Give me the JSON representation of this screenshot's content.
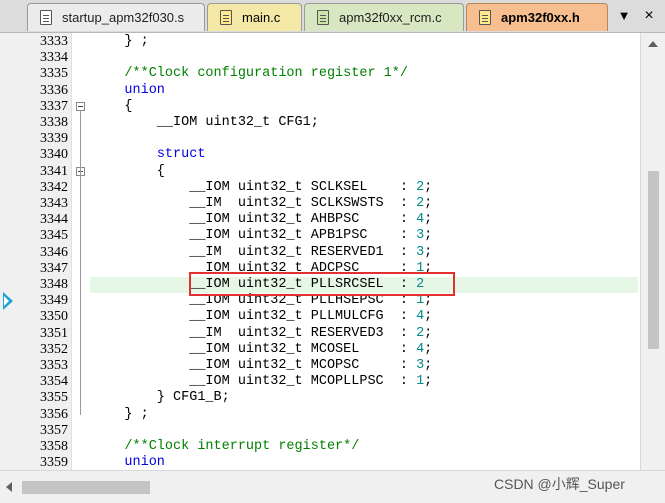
{
  "tabs": [
    {
      "label": "startup_apm32f030.s",
      "icon": "asm-file-icon"
    },
    {
      "label": "main.c",
      "icon": "c-file-icon"
    },
    {
      "label": "apm32f0xx_rcm.c",
      "icon": "c-file-icon"
    },
    {
      "label": "apm32f0xx.h",
      "icon": "header-file-icon",
      "active": true
    }
  ],
  "tab_controls": {
    "dropdown": "▼",
    "close": "×"
  },
  "editor": {
    "current_line": "3348",
    "lines": [
      {
        "n": "3333",
        "t": "    } ;"
      },
      {
        "n": "3334",
        "t": ""
      },
      {
        "n": "3335",
        "t": "    /**Clock configuration register 1*/"
      },
      {
        "n": "3336",
        "t": "    union"
      },
      {
        "n": "3337",
        "t": "    {"
      },
      {
        "n": "3338",
        "t": "        __IOM uint32_t CFG1;"
      },
      {
        "n": "3339",
        "t": ""
      },
      {
        "n": "3340",
        "t": "        struct"
      },
      {
        "n": "3341",
        "t": "        {"
      },
      {
        "n": "3342",
        "t": "            __IOM uint32_t SCLKSEL    : 2;"
      },
      {
        "n": "3343",
        "t": "            __IM  uint32_t SCLKSWSTS  : 2;"
      },
      {
        "n": "3344",
        "t": "            __IOM uint32_t AHBPSC     : 4;"
      },
      {
        "n": "3345",
        "t": "            __IOM uint32_t APB1PSC    : 3;"
      },
      {
        "n": "3346",
        "t": "            __IM  uint32_t RESERVED1  : 3;"
      },
      {
        "n": "3347",
        "t": "            __IOM uint32_t ADCPSC     : 1;"
      },
      {
        "n": "3348",
        "t": "            __IOM uint32_t PLLSRCSEL  : 2"
      },
      {
        "n": "3349",
        "t": "            __IOM uint32_t PLLHSEPSC  : 1;"
      },
      {
        "n": "3350",
        "t": "            __IOM uint32_t PLLMULCFG  : 4;"
      },
      {
        "n": "3351",
        "t": "            __IM  uint32_t RESERVED3  : 2;"
      },
      {
        "n": "3352",
        "t": "            __IOM uint32_t MCOSEL     : 4;"
      },
      {
        "n": "3353",
        "t": "            __IOM uint32_t MCOPSC     : 3;"
      },
      {
        "n": "3354",
        "t": "            __IOM uint32_t MCOPLLPSC  : 1;"
      },
      {
        "n": "3355",
        "t": "        } CFG1_B;"
      },
      {
        "n": "3356",
        "t": "    } ;"
      },
      {
        "n": "3357",
        "t": ""
      },
      {
        "n": "3358",
        "t": "    /**Clock interrupt register*/"
      },
      {
        "n": "3359",
        "t": "    union"
      }
    ],
    "folds": [
      "3337",
      "3341"
    ]
  },
  "watermark": "CSDN @小辉_Super",
  "colors": {
    "keyword": "#0000e0",
    "comment": "#008000",
    "number": "#008b8b",
    "highlight": "#e6f7e6",
    "selection_box": "#e0312e"
  }
}
